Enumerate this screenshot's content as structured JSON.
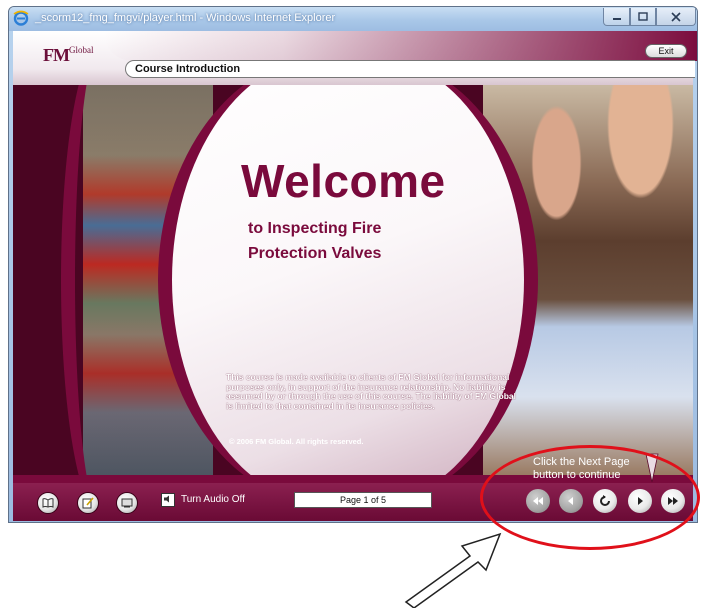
{
  "window": {
    "title": "_scorm12_fmg_fmgvi/player.html - Windows Internet Explorer"
  },
  "header": {
    "logo": "FM",
    "logo_small": "Global",
    "course_title": "Course Introduction",
    "exit_label": "Exit"
  },
  "content": {
    "welcome": "Welcome",
    "subtitle_line1": "to Inspecting Fire",
    "subtitle_line2": "Protection Valves",
    "disclaimer": "This course is made available to clients of FM Global for informational purposes only, in support of the insurance relationship. No liability is assumed by or through the use of this course. The liability of FM Global is limited to that contained in its insurance policies.",
    "copyright": "© 2006 FM Global. All rights reserved.",
    "next_hint_line1": "Click the Next Page",
    "next_hint_line2": "button to continue"
  },
  "footer": {
    "audio_label": "Turn Audio Off",
    "page_indicator": "Page 1 of 5"
  },
  "colors": {
    "brand": "#7a0a3c",
    "annotation": "#e0101a"
  },
  "icons": {
    "glossary": "book-icon",
    "notes": "notepad-icon",
    "transcript": "screen-icon",
    "audio": "speaker-icon",
    "first": "rewind-icon",
    "back": "back-icon",
    "replay": "replay-icon",
    "next": "next-icon",
    "last": "fast-forward-icon"
  }
}
